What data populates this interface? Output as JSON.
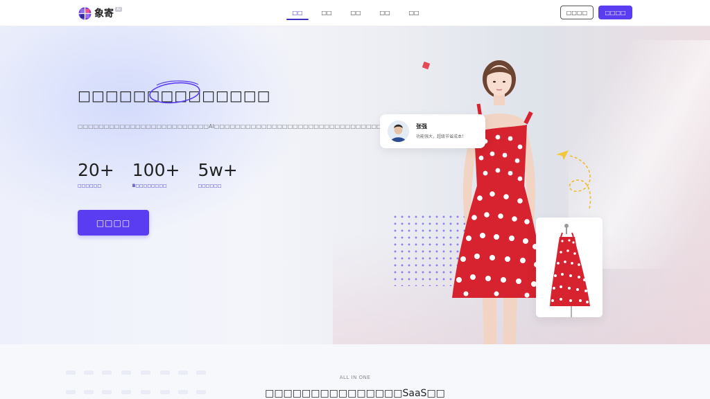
{
  "header": {
    "logo_text": "象寄",
    "logo_badge": "AI",
    "nav": [
      "□□",
      "□□",
      "□□",
      "□□",
      "□□"
    ],
    "active_index": 0,
    "login_label": "□□□□",
    "signup_label": "□□□□"
  },
  "hero": {
    "title": "□□□□□□□□□□□□□□",
    "description": "□□□□□□□□□□□□□□□□□□□□□□□□□AI□□□□□□□□□□□□□□□□□□□□□□□□□□□□□□□□□□□□□□□□□□□□□□□□□□□□□□□□□□",
    "stats": [
      {
        "value": "20+",
        "label": "□□□□□□"
      },
      {
        "value": "100+",
        "label": "B□□□□□□□□"
      },
      {
        "value": "5w+",
        "label": "□□□□□□"
      }
    ],
    "cta_label": "□□□□"
  },
  "review": {
    "name": "张强",
    "text": "功能强大，超级节省成本！"
  },
  "section2": {
    "kicker": "ALL IN ONE",
    "title": "□□□□□□□□□□□□□□□SaaS□□"
  },
  "colors": {
    "accent": "#5a3df0",
    "accent_dark": "#3d2fc4",
    "dress_red": "#d6232f"
  },
  "icons": [
    "logo-mark-icon",
    "arrow-icon",
    "dashed-circle-icon",
    "red-square-icon"
  ]
}
